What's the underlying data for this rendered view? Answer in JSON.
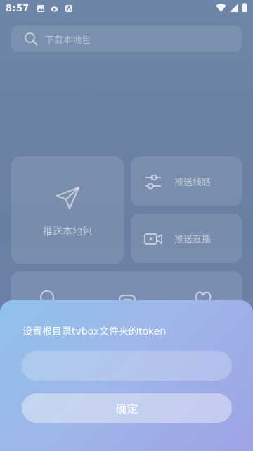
{
  "status_bar": {
    "time": "8:57",
    "left_icons": [
      "image-icon",
      "weibo-icon",
      "app-icon"
    ],
    "right_icons": [
      "wifi-icon",
      "signal-icon",
      "battery-icon"
    ]
  },
  "search": {
    "placeholder": "下载本地包"
  },
  "tiles": {
    "push_local_package": "推送本地包",
    "push_routes": "推送线路",
    "push_live": "推送直播"
  },
  "dialog": {
    "title": "设置根目录tvbox文件夹的token",
    "token_value": "",
    "confirm_label": "确定"
  },
  "colors": {
    "background": "#6d85a6",
    "sheet_gradient_start": "#8fc2ea",
    "sheet_gradient_end": "#9da2e4"
  }
}
